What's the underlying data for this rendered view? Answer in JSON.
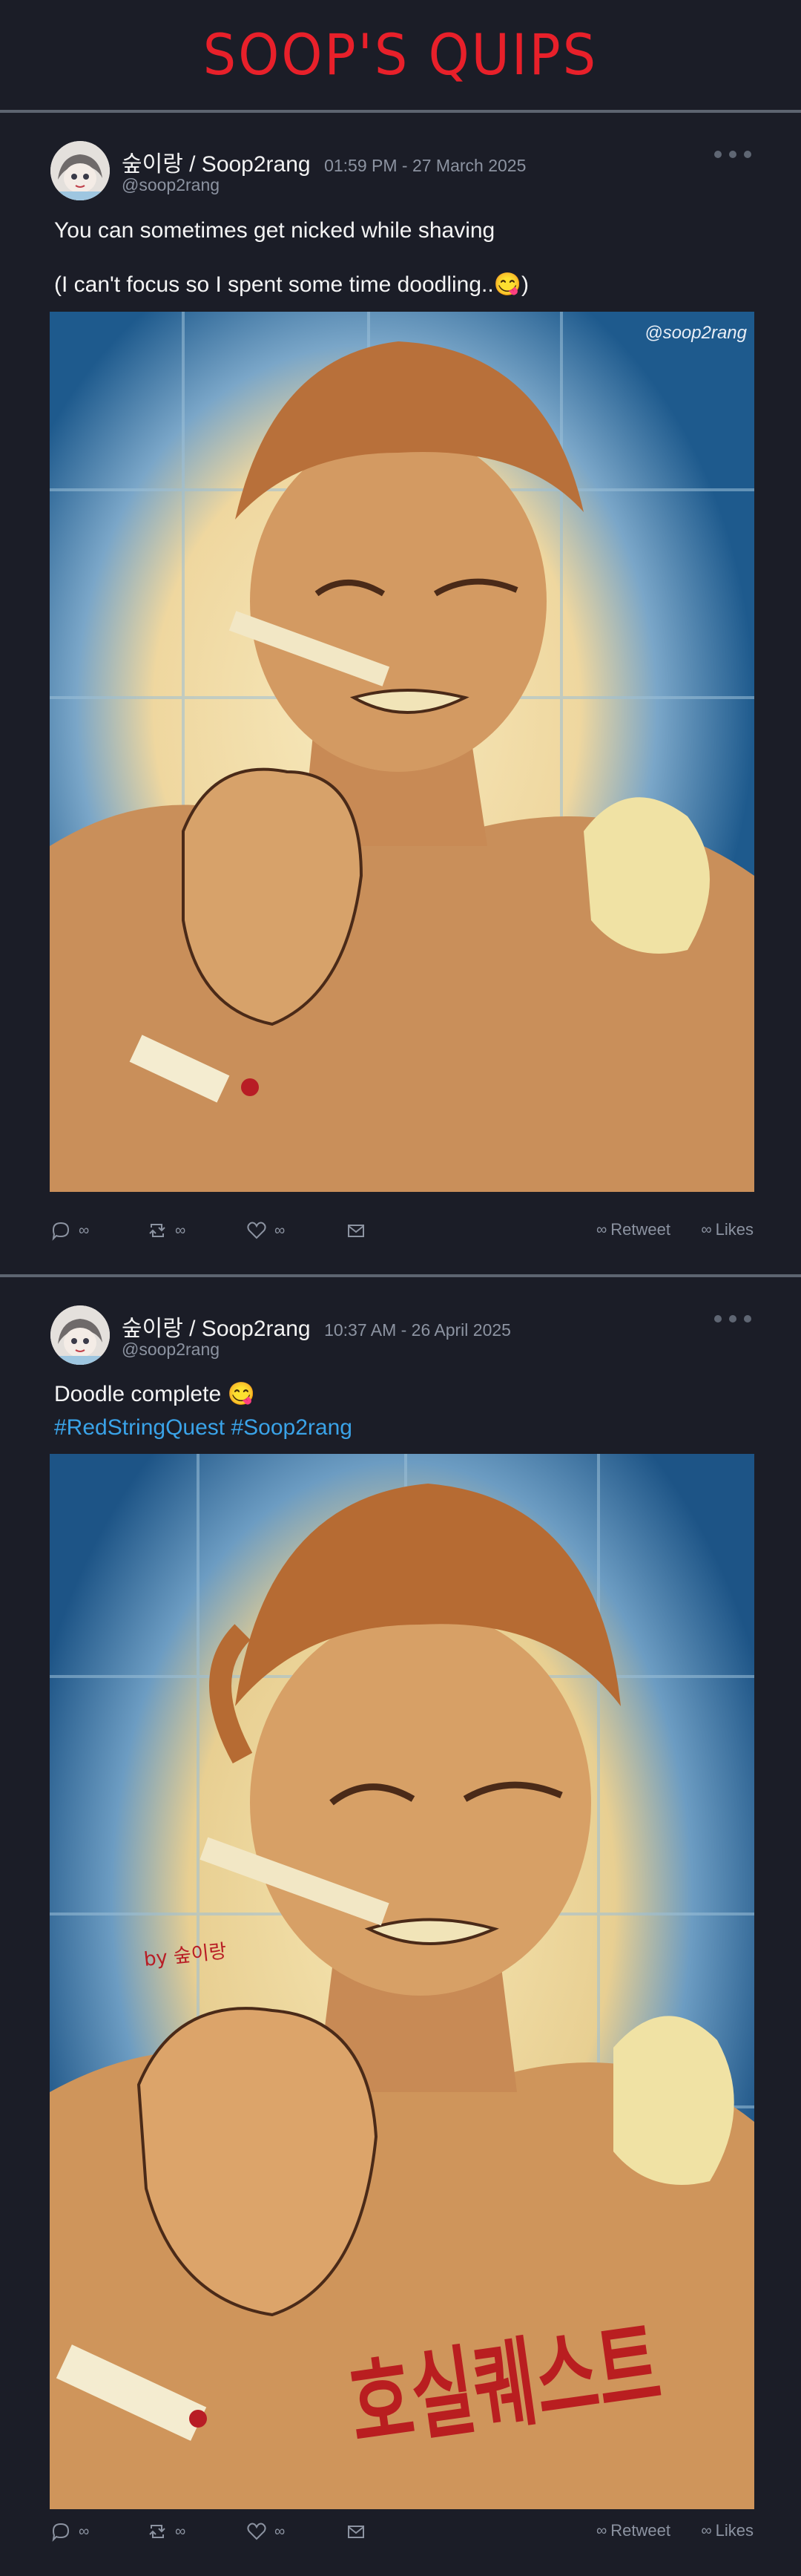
{
  "site": {
    "title": "SOOP'S QUIPS"
  },
  "colors": {
    "title_red": "#e8202a",
    "hashtag_blue": "#3aa3e8",
    "background": "#1b1d27",
    "muted": "#8c93a1"
  },
  "posts": [
    {
      "author_name": "숲이랑 / Soop2rang",
      "timestamp": "01:59 PM - 27 March 2025",
      "handle": "@soop2rang",
      "text_lines": [
        "You can sometimes get nicked while shaving",
        "(I can't focus so I spent some time doodling..😋)"
      ],
      "image_watermark": "@soop2rang",
      "actions": {
        "reply_count": "∞",
        "retweet_count": "∞",
        "like_count": "∞",
        "retweet_label": "Retweet",
        "likes_label": "Likes",
        "retweet_stat": "∞",
        "likes_stat": "∞"
      }
    },
    {
      "author_name": "숲이랑 / Soop2rang",
      "timestamp": "10:37 AM - 26 April 2025",
      "handle": "@soop2rang",
      "text_lines": [
        "Doodle complete 😋"
      ],
      "hashtags": [
        "#RedStringQuest",
        "#Soop2rang"
      ],
      "image_signature": "by 숲이랑",
      "image_title": "호실퀘스트",
      "actions": {
        "reply_count": "∞",
        "retweet_count": "∞",
        "like_count": "∞",
        "retweet_label": "Retweet",
        "likes_label": "Likes",
        "retweet_stat": "∞",
        "likes_stat": "∞"
      }
    }
  ]
}
